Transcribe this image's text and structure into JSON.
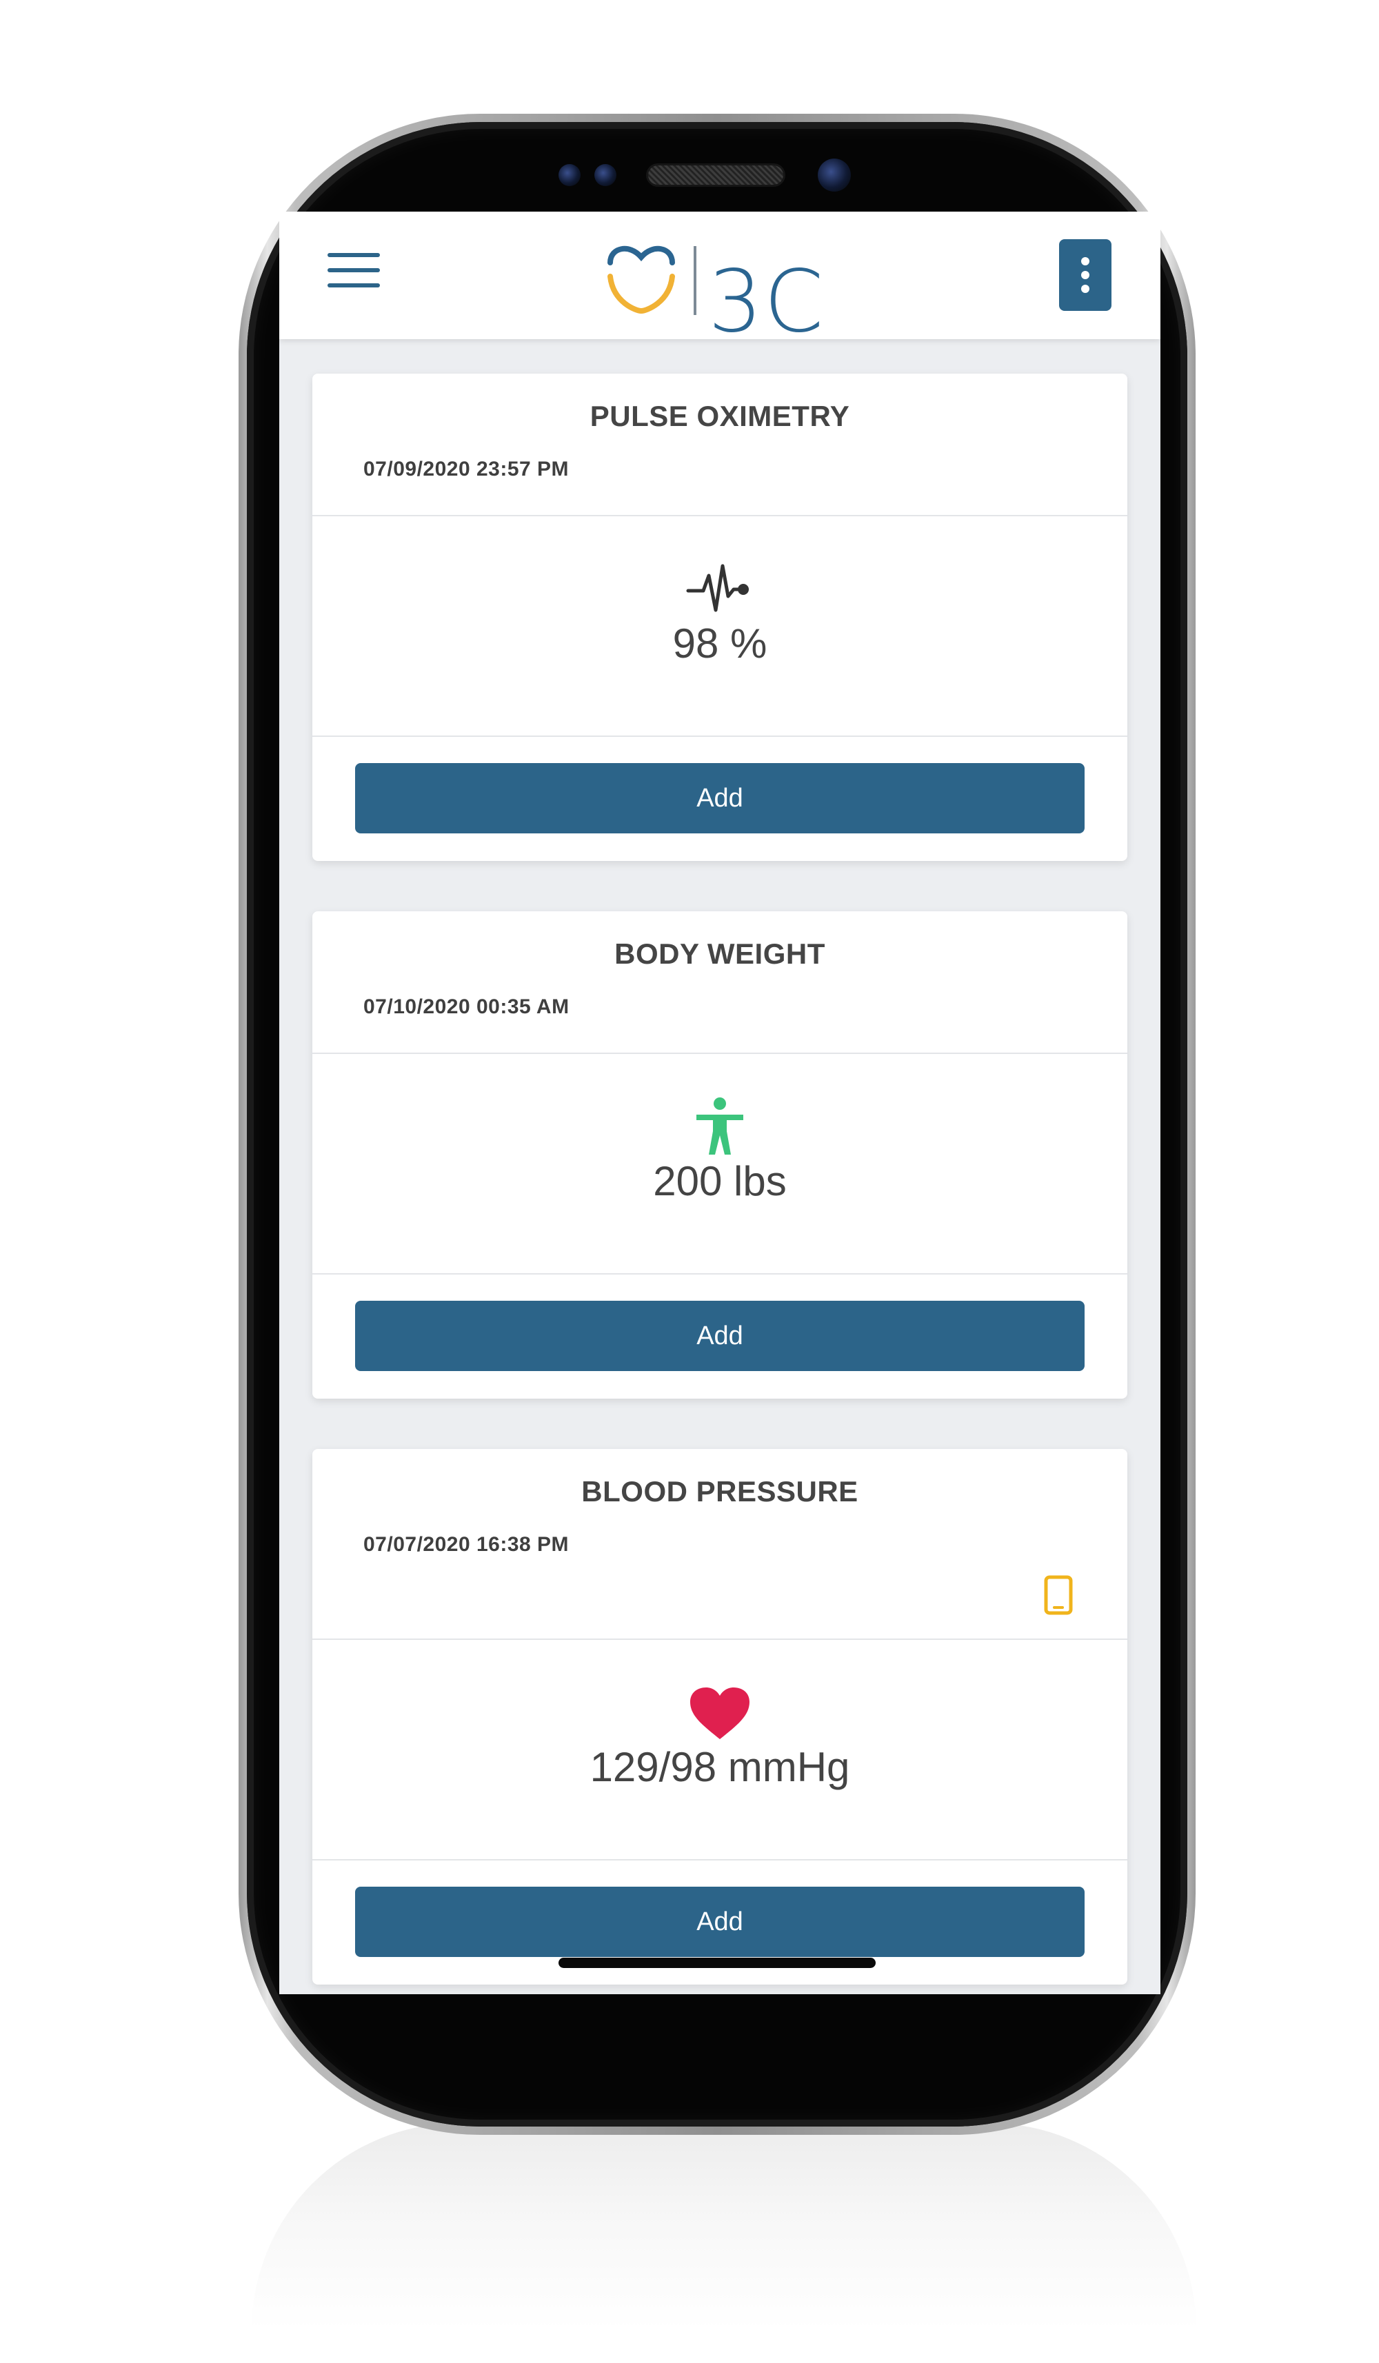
{
  "app": {
    "logo_text": "3C",
    "brand_color": "#2c6489",
    "logo_accent_color": "#f1b235"
  },
  "header": {
    "menu_icon": "hamburger-menu-icon",
    "more_icon": "vertical-dots-icon"
  },
  "cards": [
    {
      "title": "PULSE OXIMETRY",
      "date": "07/09/2020 23:57 PM",
      "icon": "pulse-wave-icon",
      "value": "98 %",
      "button_label": "Add"
    },
    {
      "title": "BODY WEIGHT",
      "date": "07/10/2020 00:35 AM",
      "icon": "body-figure-icon",
      "icon_color": "#3cc47c",
      "value": "200 lbs",
      "button_label": "Add"
    },
    {
      "title": "BLOOD PRESSURE",
      "date": "07/07/2020 16:38 PM",
      "icon": "heart-icon",
      "icon_color": "#e0204f",
      "device_icon": "mobile-phone-icon",
      "device_icon_color": "#f0b41c",
      "value": "129/98 mmHg",
      "button_label": "Add"
    }
  ]
}
